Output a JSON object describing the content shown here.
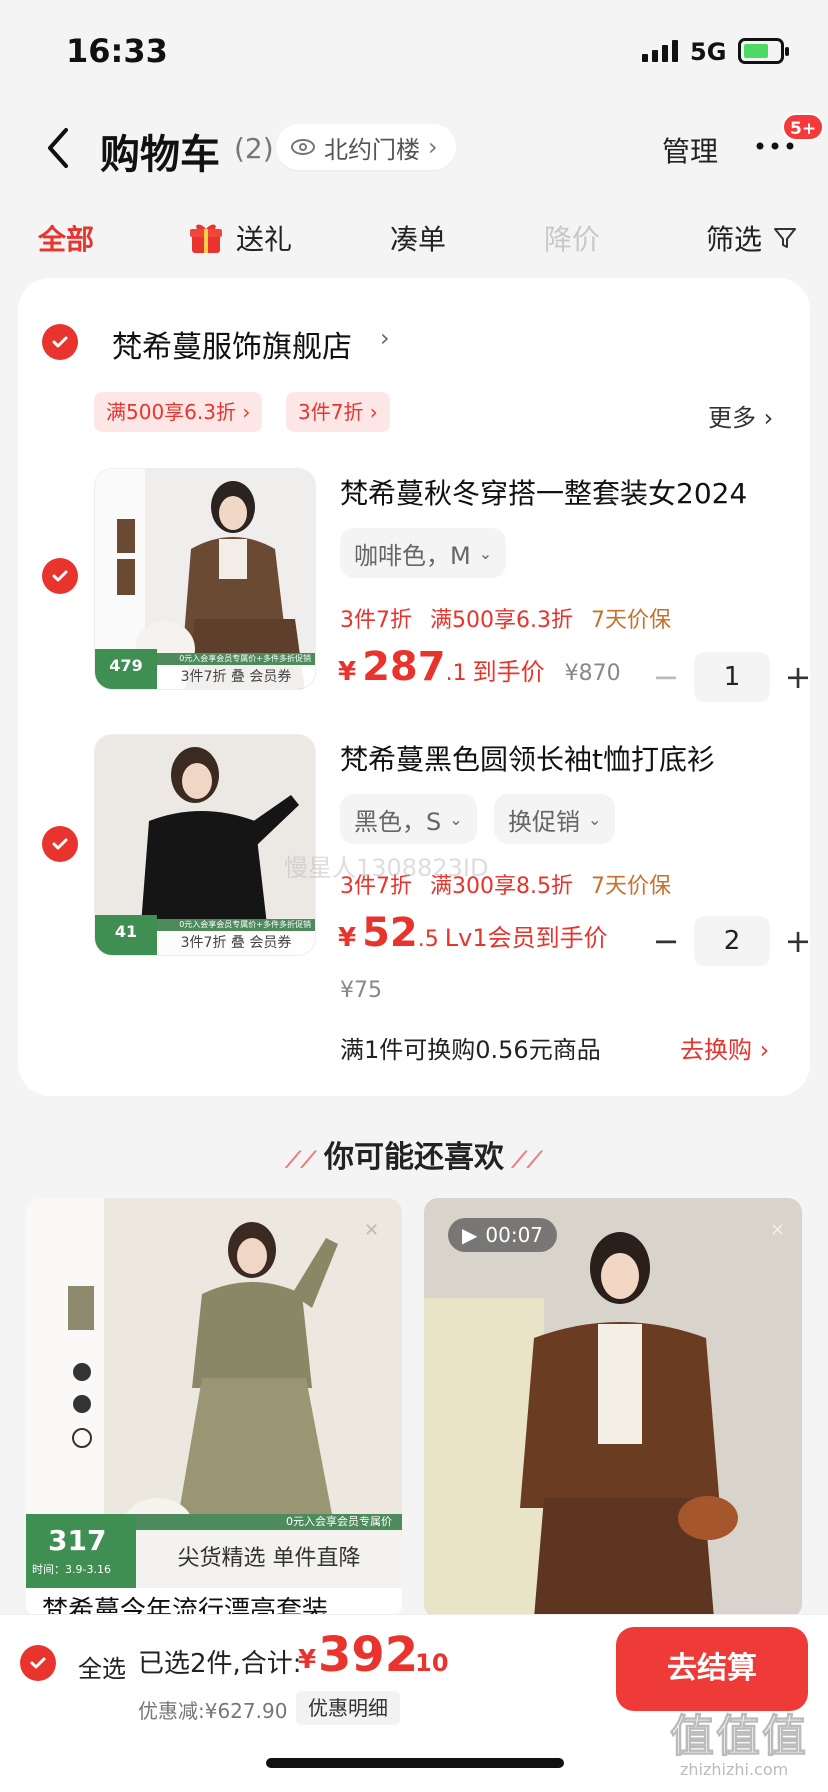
{
  "status_bar": {
    "time": "16:33",
    "network": "5G"
  },
  "header": {
    "title": "购物车",
    "count": "(2)",
    "location": "北约门楼",
    "manage": "管理",
    "badge": "5+"
  },
  "tabs": {
    "all": "全部",
    "gift": "送礼",
    "bundle": "凑单",
    "price_drop": "降价",
    "filter": "筛选"
  },
  "shop": {
    "name": "梵希蔓服饰旗舰店",
    "promos": [
      "满500享6.3折 ›",
      "3件7折 ›"
    ],
    "more": "更多 ›"
  },
  "items": [
    {
      "name": "梵希蔓秋冬穿搭一整套装女2024",
      "variant": "咖啡色，M",
      "tags": [
        "3件7折",
        "满500享6.3折",
        "7天价保"
      ],
      "price_symbol": "¥",
      "price_int": "287",
      "price_dec": ".1",
      "price_note": "到手价",
      "orig_price": "¥870",
      "qty": "1",
      "thumb_price": "479",
      "thumb_caption": "3件7折 叠 会员券",
      "thumb_strip": "0元入会享会员专属价+多件多折促销"
    },
    {
      "name": "梵希蔓黑色圆领长袖t恤打底衫",
      "variant": "黑色，S",
      "variant2": "换促销",
      "tags": [
        "3件7折",
        "满300享8.5折",
        "7天价保"
      ],
      "price_symbol": "¥",
      "price_int": "52",
      "price_dec": ".5",
      "price_note": "Lv1会员到手价",
      "orig_price": "¥75",
      "qty": "2",
      "thumb_price": "41",
      "thumb_caption": "3件7折 叠 会员券",
      "thumb_strip": "0元入会享会员专属价+多件多折促销",
      "exchange_text": "满1件可换购0.56元商品",
      "exchange_link": "去换购 ›"
    }
  ],
  "faint_watermark": "慢星人1308823ID",
  "recommend": {
    "title": "你可能还喜欢",
    "left": {
      "price": "317",
      "price_note": "时间：3.9-3.16",
      "banner": "尖货精选 单件直降",
      "strip": "0元入会享会员专属价",
      "title": "梵希蔓今年流行漂亮套装"
    },
    "right": {
      "video": "00:07"
    }
  },
  "bottom": {
    "select_all": "全选",
    "selected": "已选2件,合计:",
    "total_symbol": "¥",
    "total_int": "392",
    "total_dec": ".10",
    "discount": "优惠减:¥627.90",
    "discount_detail": "优惠明细",
    "checkout": "去结算"
  },
  "watermark": {
    "brand": "值值值",
    "url": "zhizhizhi.com"
  },
  "colors": {
    "accent": "#e8342d",
    "checkout": "#ee3b38",
    "promo_bg": "#fde7e6",
    "orange": "#c7712b",
    "thumb_green": "#3f8e52"
  }
}
